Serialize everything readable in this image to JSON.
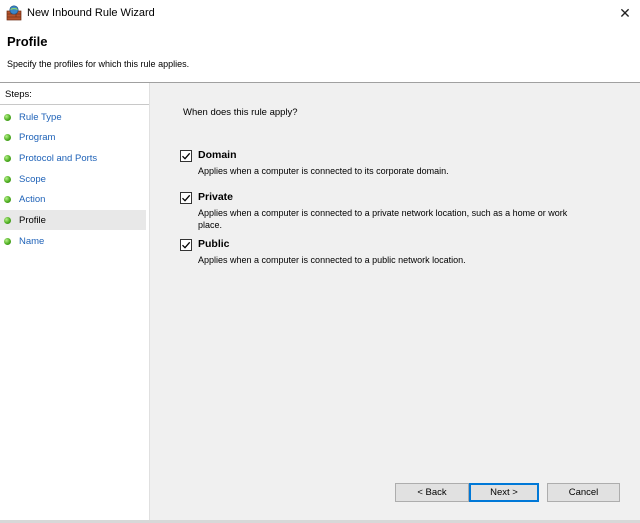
{
  "window": {
    "title": "New Inbound Rule Wizard",
    "close_glyph": "✕",
    "icon": "firewall-icon"
  },
  "header": {
    "title": "Profile",
    "subtitle": "Specify the profiles for which this rule applies."
  },
  "sidebar": {
    "heading": "Steps:",
    "items": [
      {
        "label": "Rule Type",
        "active": false
      },
      {
        "label": "Program",
        "active": false
      },
      {
        "label": "Protocol and Ports",
        "active": false
      },
      {
        "label": "Scope",
        "active": false
      },
      {
        "label": "Action",
        "active": false
      },
      {
        "label": "Profile",
        "active": true
      },
      {
        "label": "Name",
        "active": false
      }
    ],
    "dot_color": "#4fae22"
  },
  "main": {
    "question": "When does this rule apply?",
    "options": [
      {
        "label": "Domain",
        "checked": true,
        "description": "Applies when a computer is connected to its corporate domain."
      },
      {
        "label": "Private",
        "checked": true,
        "description": "Applies when a computer is connected to a private network location, such as a home or work place."
      },
      {
        "label": "Public",
        "checked": true,
        "description": "Applies when a computer is connected to a public network location."
      }
    ]
  },
  "buttons": {
    "back": "< Back",
    "next": "Next >",
    "cancel": "Cancel"
  },
  "colors": {
    "link": "#2063b8",
    "panel_bg": "#f0f0f0",
    "default_button_border": "#0078d7"
  }
}
